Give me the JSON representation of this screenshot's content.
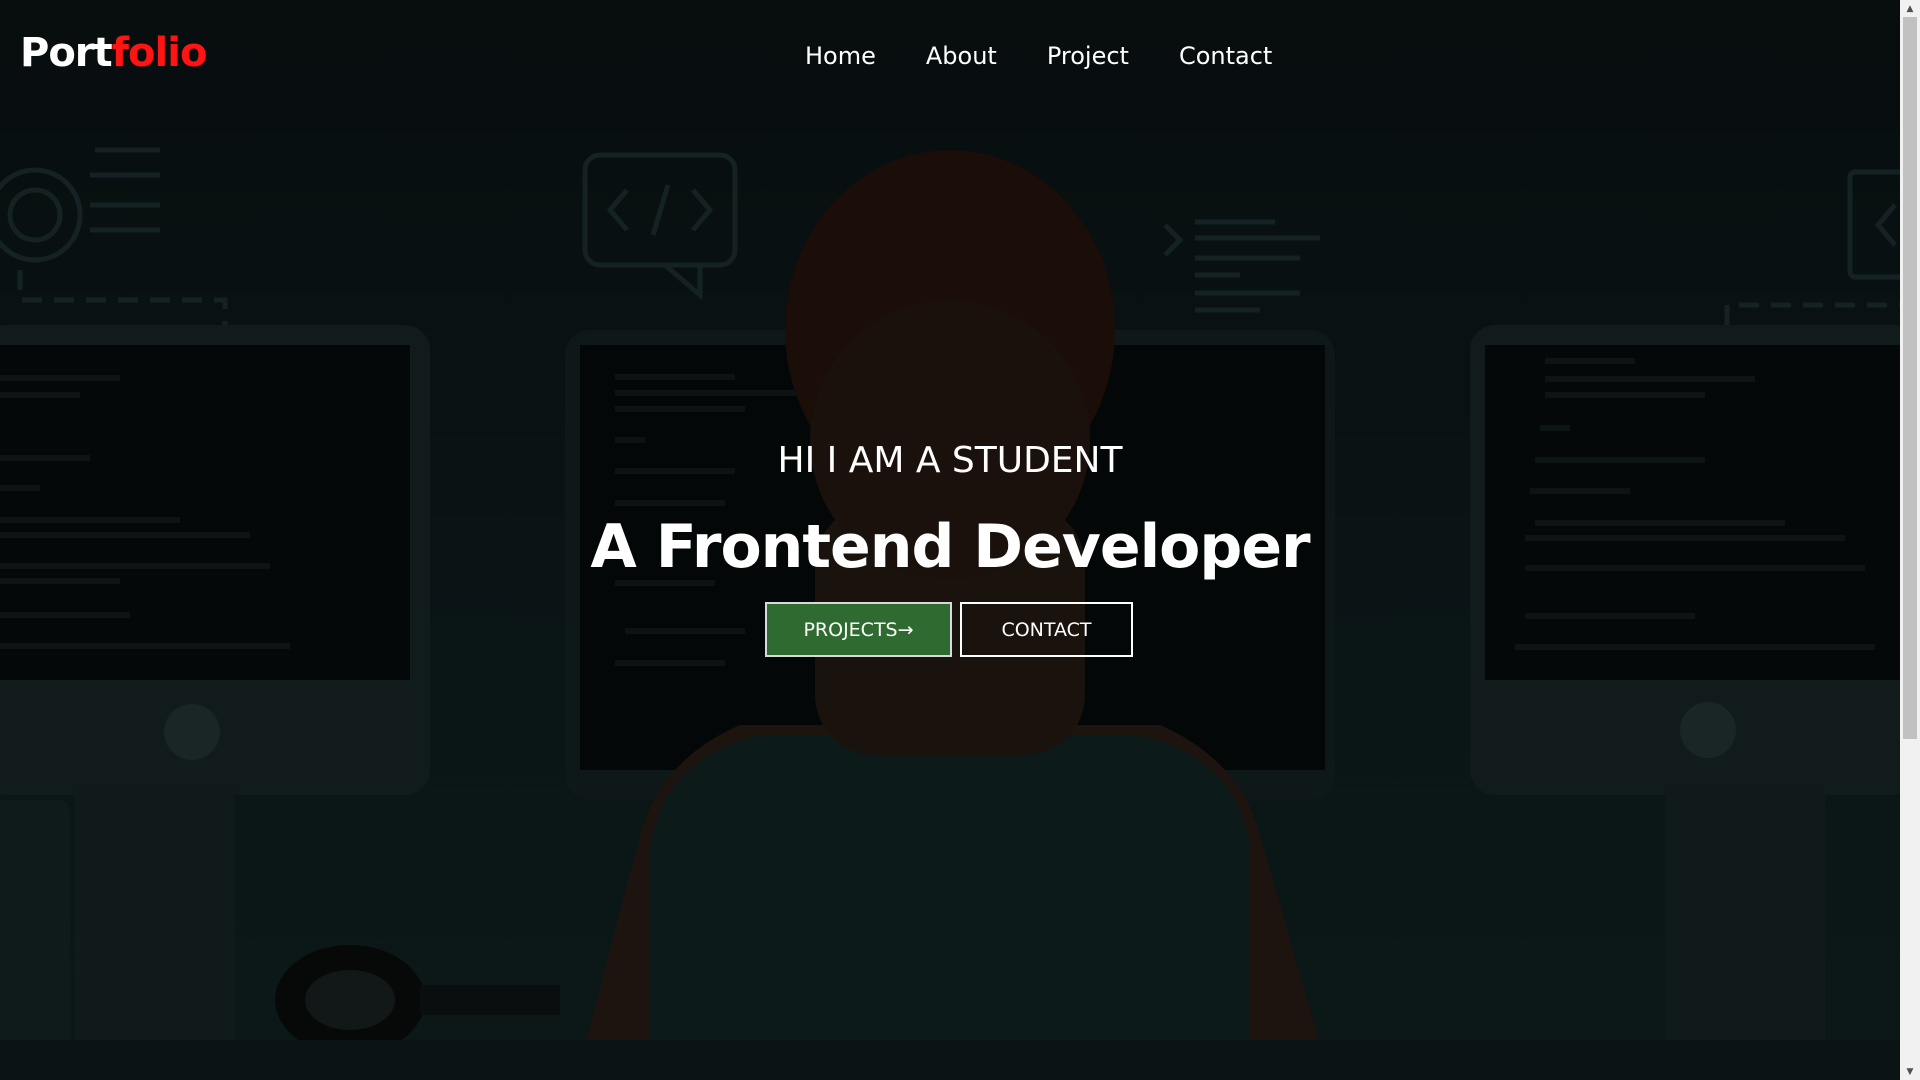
{
  "logo": {
    "part1": "Port",
    "part2": "folio",
    "accent_color": "#ff1414"
  },
  "nav": {
    "items": [
      {
        "label": "Home"
      },
      {
        "label": "About"
      },
      {
        "label": "Project"
      },
      {
        "label": "Contact"
      }
    ]
  },
  "hero": {
    "subtitle": "HI I AM A STUDENT",
    "title": "A Frontend Developer",
    "buttons": {
      "projects_label": "PROJECTS→",
      "contact_label": "CONTACT"
    },
    "projects_button_color": "#2f6b30"
  },
  "scrollbar": {
    "up_icon": "▲",
    "down_icon": "▼"
  }
}
